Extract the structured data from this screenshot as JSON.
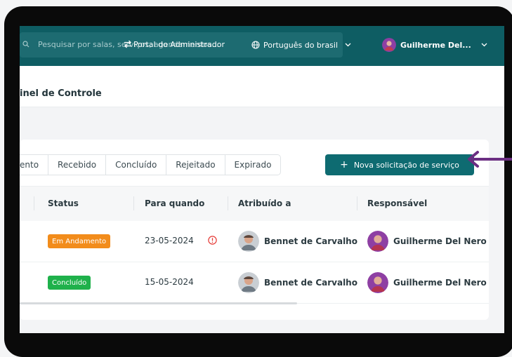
{
  "header": {
    "search_placeholder": "Pesquisar por salas, serviços, agendamentos...",
    "portal_label": "Portal do Administrador",
    "language": "Português do brasil",
    "user_name": "Guilherme Del..."
  },
  "page": {
    "title": "inel de Controle"
  },
  "tabs": [
    {
      "label": "ento"
    },
    {
      "label": "Recebido"
    },
    {
      "label": "Concluído"
    },
    {
      "label": "Rejeitado"
    },
    {
      "label": "Expirado"
    }
  ],
  "new_request_button": {
    "label": "Nova solicitação de serviço"
  },
  "table": {
    "columns": [
      "Status",
      "Para quando",
      "Atribuído a",
      "Responsável"
    ],
    "rows": [
      {
        "status": "Em Andamento",
        "status_color": "#f28c1b",
        "date": "23-05-2024",
        "overdue": true,
        "assigned": "Bennet de Carvalho",
        "responsible": "Guilherme Del Nero"
      },
      {
        "status": "Concluído",
        "status_color": "#1fb14b",
        "date": "15-05-2024",
        "overdue": false,
        "assigned": "Bennet de Carvalho",
        "responsible": "Guilherme Del Nero"
      }
    ]
  },
  "colors": {
    "brand": "#0e5d63",
    "button": "#0e6b71",
    "annotation_arrow": "#6b2e82",
    "alert": "#e53935"
  }
}
